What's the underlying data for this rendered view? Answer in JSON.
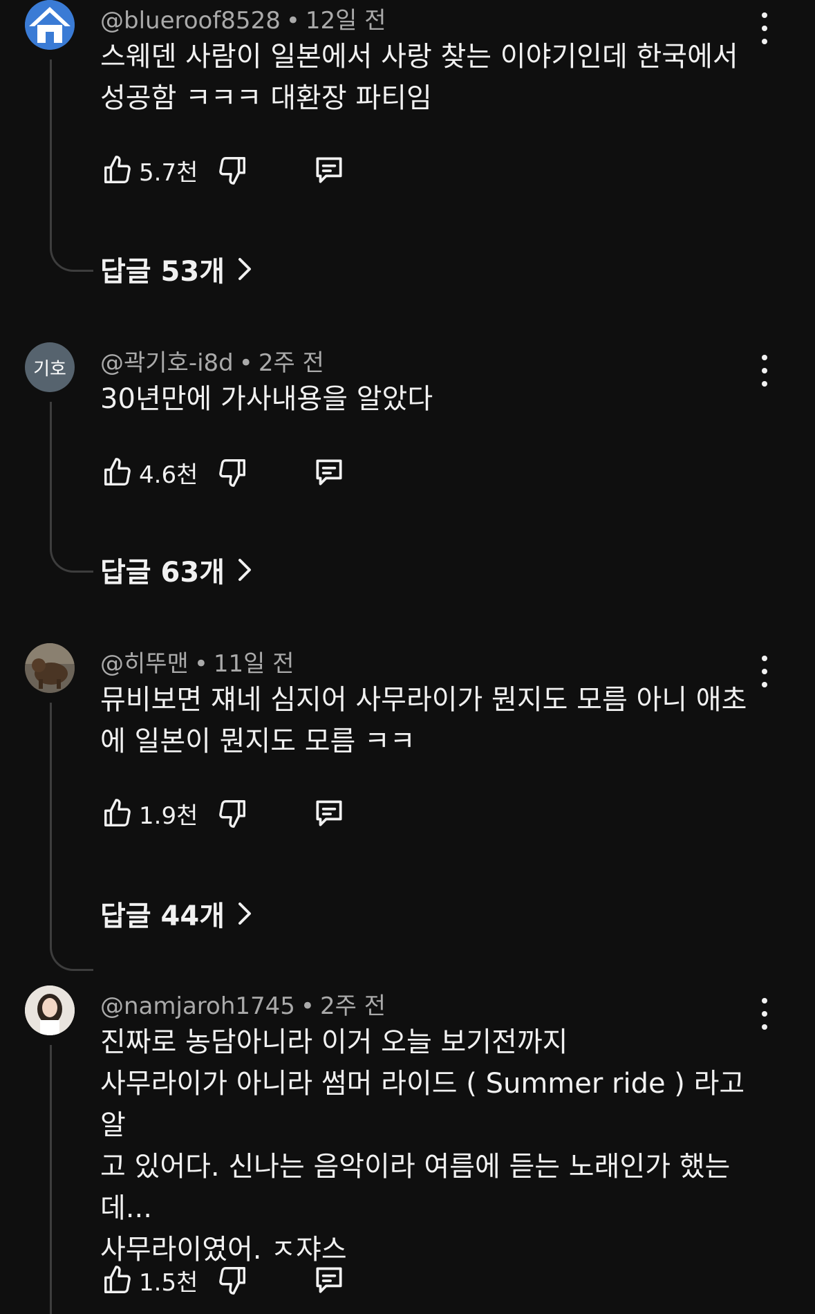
{
  "comments": [
    {
      "avatar": {
        "type": "house-icon",
        "bg": "#3a7bd5"
      },
      "handle": "@blueroof8528",
      "time": "12일 전",
      "text": "스웨덴 사람이 일본에서 사랑 찾는 이야기인데 한국에서\n성공함 ㅋㅋㅋ 대환장 파티임",
      "likes": "5.7천",
      "replies": "답글 53개"
    },
    {
      "avatar": {
        "type": "text",
        "label": "기호",
        "bg": "#56636e"
      },
      "handle": "@곽기호-i8d",
      "time": "2주 전",
      "text": "30년만에 가사내용을 알았다",
      "likes": "4.6천",
      "replies": "답글 63개"
    },
    {
      "avatar": {
        "type": "photo-bear",
        "bg": "#5a4a3a"
      },
      "handle": "@히뚜맨",
      "time": "11일 전",
      "text": "뮤비보면 쟤네 심지어 사무라이가 뭔지도 모름 아니 애초\n에 일본이 뭔지도 모름 ㅋㅋ",
      "likes": "1.9천",
      "replies": "답글 44개"
    },
    {
      "avatar": {
        "type": "photo-woman",
        "bg": "#e9e4de"
      },
      "handle": "@namjaroh1745",
      "time": "2주 전",
      "text": "진짜로 농담아니라 이거 오늘 보기전까지\n사무라이가 아니라 썸머 라이드 ( Summer ride ) 라고 알\n고 있어다. 신나는 음악이라 여름에 듣는 노래인가 했는\n데...\n사무라이였어. ㅈ쟈스",
      "likes": "1.5천",
      "replies": ""
    }
  ],
  "separator": "•",
  "colors": {
    "background": "#0f0f0f",
    "text": "#f1f1f1",
    "meta": "#aaaaaa",
    "thread": "#3d3d3d"
  }
}
